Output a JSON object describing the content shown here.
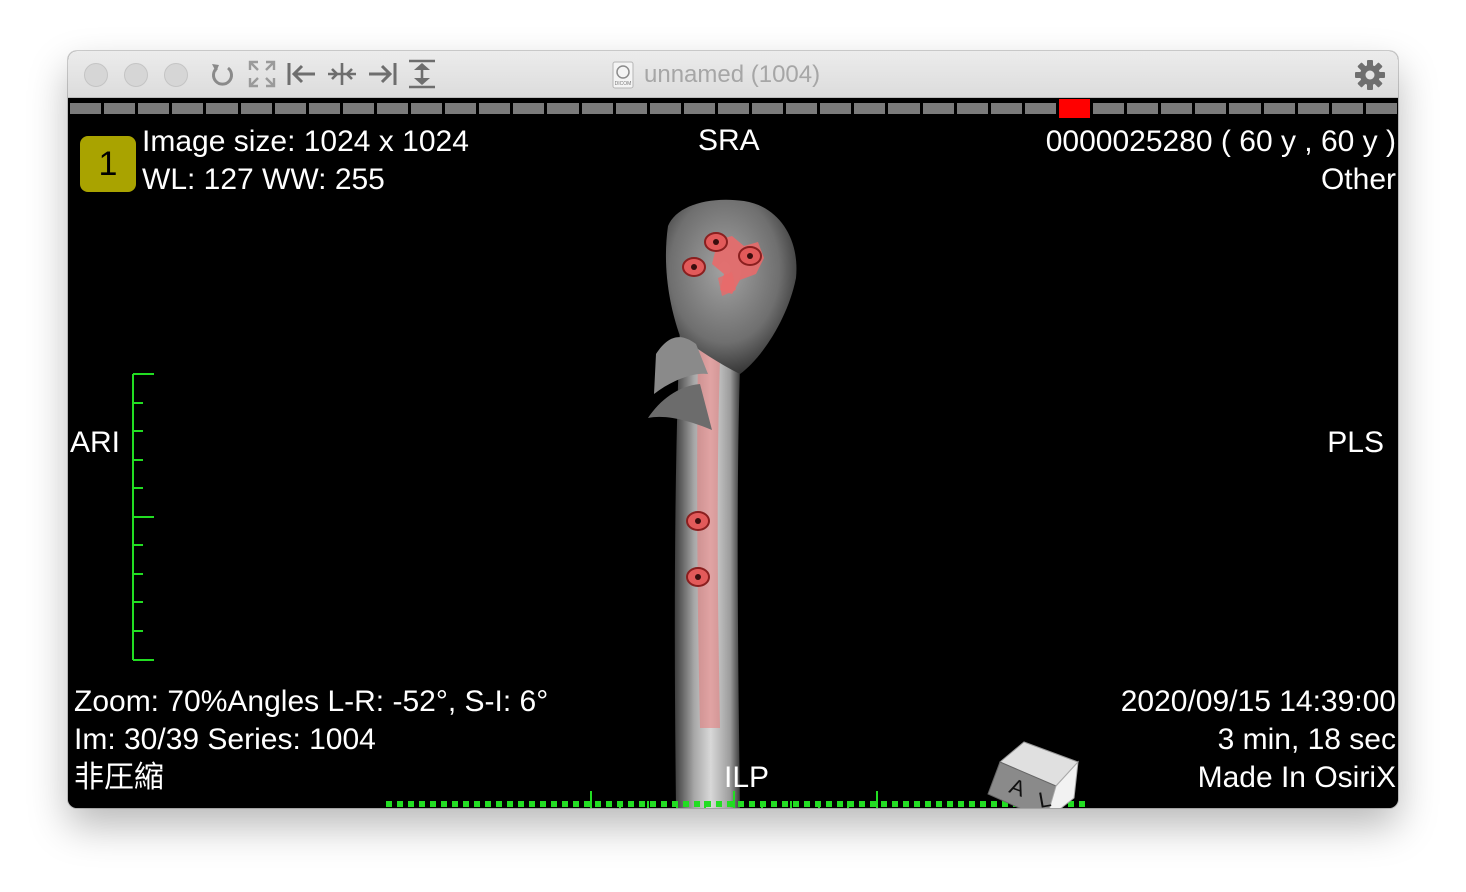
{
  "window": {
    "title": "unnamed (1004)",
    "doc_icon_label": "DICOM"
  },
  "toolbar": {
    "icons": [
      "reset-rotation-icon",
      "fullscreen-icon",
      "first-image-icon",
      "center-icon",
      "last-image-icon",
      "stack-icon"
    ]
  },
  "progress": {
    "segments": 39,
    "current": 30,
    "colors": {
      "inactive": "#7b7b7b",
      "active": "#ff0000"
    }
  },
  "overlay": {
    "badge": "1",
    "image_size": "Image size: 1024 x 1024",
    "wl_ww": "WL: 127 WW: 255",
    "top_center": "SRA",
    "patient_line": "0000025280 (  60 y ,  60 y )",
    "modality": "Other",
    "left_orientation": "ARI",
    "right_orientation": "PLS",
    "bottom_orientation": "ILP",
    "zoom_angles": "Zoom: 70%Angles L-R: -52°, S-I: 6°",
    "image_series": "Im: 30/39  Series:  1004",
    "compression": "非圧縮",
    "datetime": "2020/09/15 14:39:00",
    "duration": "3 min, 18 sec",
    "made_in": "Made In OsiriX"
  },
  "orientation_cube": {
    "face_1": "A",
    "face_2": "L"
  },
  "colors": {
    "scale_green": "#22dd22",
    "badge": "#a9a300"
  }
}
